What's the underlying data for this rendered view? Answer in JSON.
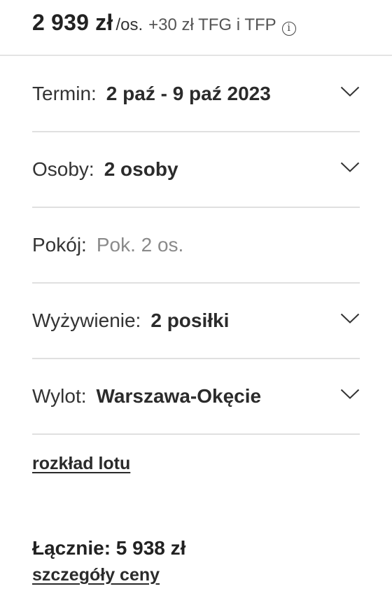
{
  "header": {
    "price": "2 939 zł",
    "per_person": "/os.",
    "extra_fee": "+30 zł TFG i TFP",
    "info_icon": "info-circle-icon"
  },
  "options": [
    {
      "label": "Termin:",
      "value": "2 paź - 9 paź 2023",
      "has_dropdown": true
    },
    {
      "label": "Osoby:",
      "value": "2 osoby",
      "has_dropdown": true
    },
    {
      "label": "Pokój:",
      "value": "Pok. 2 os.",
      "has_dropdown": false
    },
    {
      "label": "Wyżywienie:",
      "value": "2 posiłki",
      "has_dropdown": true
    },
    {
      "label": "Wylot:",
      "value": "Warszawa-Okęcie",
      "has_dropdown": true
    }
  ],
  "links": {
    "flight_schedule": "rozkład lotu",
    "price_details": "szczegóły ceny"
  },
  "total": {
    "text": "Łącznie: 5 938 zł"
  },
  "icons": {
    "dropdown": "chevron-down-icon"
  },
  "colors": {
    "text": "#2b2b2b",
    "muted": "#8a8a8a",
    "divider": "#e0e0e0"
  }
}
